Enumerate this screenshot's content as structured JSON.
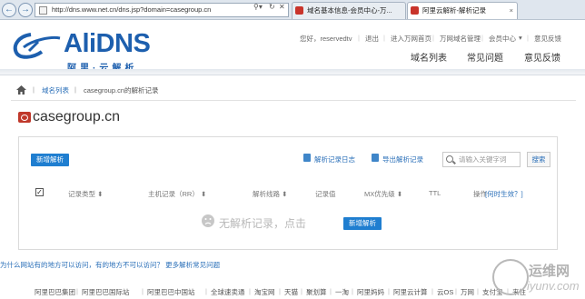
{
  "browser": {
    "address": "http://dns.www.net.cn/dns.jsp?domain=casegroup.cn",
    "tabs": [
      {
        "label": "域名基本信息-会员中心-万..."
      },
      {
        "label": "阿里云解析-解析记录"
      }
    ]
  },
  "header": {
    "logo_text": "AliDNS",
    "logo_sub": "阿里·云解析",
    "top_links": [
      "您好，reservedtv",
      "退出",
      "进入万网首页",
      "万网域名管理",
      "会员中心",
      "意见反馈"
    ],
    "main_nav": [
      "域名列表",
      "常见问题",
      "意见反馈"
    ]
  },
  "breadcrumb": {
    "items": [
      "域名列表",
      "casegroup.cn的解析记录"
    ]
  },
  "domain": {
    "name": "casegroup.cn"
  },
  "panel": {
    "add_button": "新增解析",
    "tools": {
      "log": "解析记录日志",
      "export": "导出解析记录"
    },
    "search": {
      "placeholder": "请输入关键字词",
      "button": "搜索"
    },
    "columns": [
      "记录类型",
      "主机记录（RR）",
      "解析线路",
      "记录值",
      "MX优先级",
      "TTL",
      "操作",
      "[何时生效？]"
    ],
    "empty": {
      "text": "无解析记录，点击",
      "button": "新增解析"
    }
  },
  "help_link": "为什么网站有的地方可以访问，有的地方不可以访问？ 更多解析常见问题",
  "footer": {
    "links": [
      "阿里巴巴集团",
      "阿里巴巴国际站",
      "阿里巴巴中国站",
      "全球速卖通",
      "淘宝网",
      "天猫",
      "聚划算",
      "一淘",
      "阿里妈妈",
      "阿里云计算",
      "云OS",
      "万网",
      "支付宝",
      "来往"
    ]
  },
  "watermark": {
    "line1": "运维网",
    "line2": "iyunv.com"
  },
  "colors": {
    "accent": "#1f7ed0",
    "link": "#2a6fb8",
    "brand": "#1d5fae"
  }
}
